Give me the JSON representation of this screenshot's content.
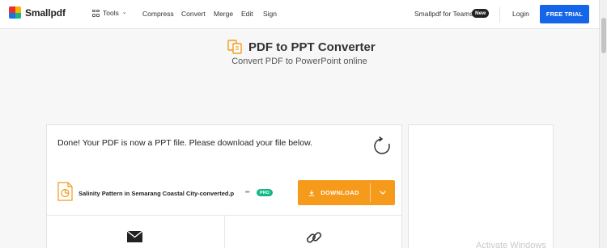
{
  "header": {
    "brand": "Smallpdf",
    "tools_label": "Tools",
    "nav": [
      "Compress",
      "Convert",
      "Merge",
      "Edit",
      "Sign"
    ],
    "teams_label": "Smallpdf for Teams",
    "new_badge": "New",
    "login_label": "Login",
    "trial_label": "FREE TRIAL"
  },
  "page": {
    "title": "PDF to PPT Converter",
    "subtitle": "Convert PDF to PowerPoint online"
  },
  "result": {
    "message": "Done! Your PDF is now a PPT file. Please download your file below.",
    "file_name": "Salinity Pattern in Semarang Coastal City-converted.p",
    "pro_badge": "PRO",
    "download_label": "DOWNLOAD"
  },
  "watermark": "Activate Windows",
  "colors": {
    "accent": "#1565e8",
    "download": "#f59a1b",
    "file_icon": "#f59a1b",
    "pro": "#12b886"
  }
}
